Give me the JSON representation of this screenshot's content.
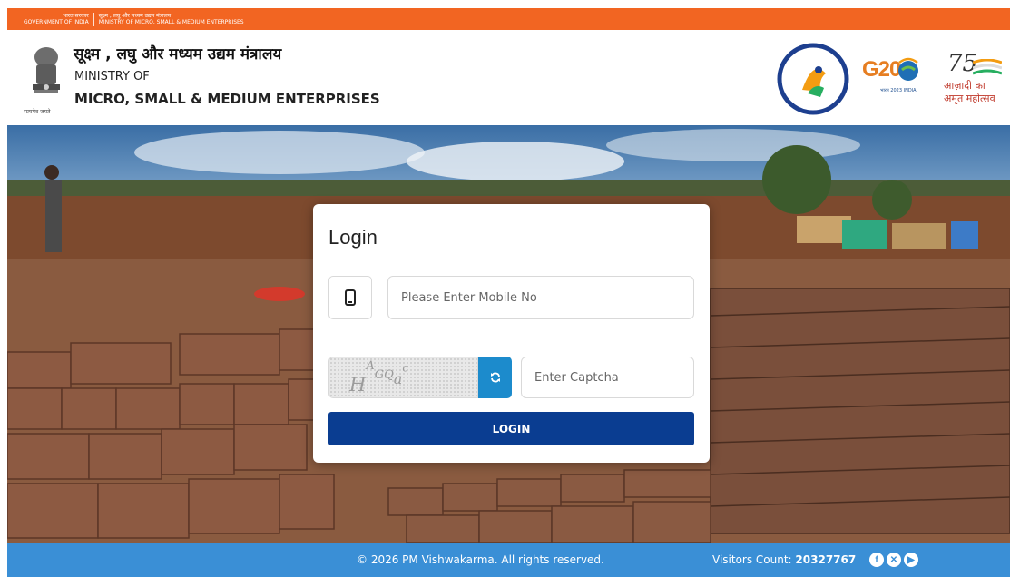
{
  "gov_strip": {
    "hindi_line1": "भारत सरकार",
    "english_line1": "GOVERNMENT OF INDIA",
    "hindi_line2": "सूक्ष्म , लघु और मध्यम उद्यम मंत्रालय",
    "english_line2": "MINISTRY OF MICRO, SMALL & MEDIUM ENTERPRISES"
  },
  "header": {
    "title_hindi": "सूक्ष्म , लघु और मध्यम उद्यम मंत्रालय",
    "ministry_of": "MINISTRY OF",
    "ministry_name": "MICRO, SMALL & MEDIUM ENTERPRISES",
    "emblem_caption": "सत्यमेव जयते",
    "logos": {
      "g20_text": "G20",
      "g20_sub": "भारत 2023 INDIA",
      "azadi_75": "75",
      "azadi_line1": "आज़ादी का",
      "azadi_line2": "अमृत महोत्सव"
    }
  },
  "login": {
    "title": "Login",
    "mobile_placeholder": "Please Enter Mobile No",
    "captcha_text": "HAGQac",
    "captcha_placeholder": "Enter Captcha",
    "login_button": "LOGIN"
  },
  "footer": {
    "copyright": "© 2026 PM Vishwakarma. All rights reserved.",
    "visitors_label": "Visitors Count:",
    "visitors_count": "20327767",
    "social": [
      "facebook-icon",
      "x-icon",
      "youtube-icon"
    ]
  },
  "colors": {
    "orange_strip": "#f26522",
    "footer_blue": "#3a8fd6",
    "login_button": "#0a3d91",
    "refresh_button": "#1c8bcc"
  }
}
